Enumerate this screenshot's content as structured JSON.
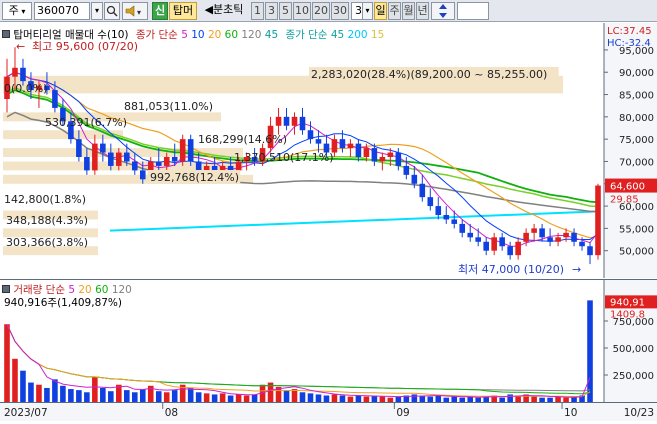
{
  "toolbar": {
    "market": "주",
    "code": "360070",
    "search_icon": "magnifier-icon",
    "sound_icon": "speaker-icon",
    "new_button": "신",
    "tab_button": "탑머",
    "split_label": "◀분초틱",
    "period_buttons": [
      "1",
      "3",
      "5",
      "10",
      "20",
      "30"
    ],
    "count_value": "3",
    "day_button": "일",
    "week_button": "주",
    "month_button": "월",
    "year_button": "년",
    "updown_icon": "updown-arrow-icon"
  },
  "price_header": {
    "stock": "탑머티리얼 매물대 수(10)",
    "sma_label": "종가 단순",
    "sma_periods": [
      "5",
      "10",
      "20",
      "60",
      "120",
      "45"
    ],
    "sma_colors": [
      "#d020d0",
      "#0040ff",
      "#f0a020",
      "#10b010",
      "#808080",
      "#00a0a0"
    ],
    "env_label": "종가 단순",
    "env_periods": [
      "45",
      "200",
      "15"
    ],
    "env_colors": [
      "#10a0a0",
      "#00c8ff",
      "#e0c040"
    ],
    "lc_label": "LC:37.45",
    "hc_label": "HC:-32.4"
  },
  "annotations": {
    "high": "최고 95,600 (07/20)",
    "low": "최저 47,000 (10/20)",
    "zero": "0(0.0%)",
    "volume_profile": [
      "2,283,020(28.4%)(89,200.00 ~ 85,255.00)",
      "881,053(11.0%)",
      "530,391(6.7%)",
      "168,299(14.6%)",
      "1,370,510(17.1%)",
      "992,768(12.4%)",
      "142,800(1.8%)",
      "348,188(4.3%)",
      "303,366(3.8%)"
    ]
  },
  "price_axis": {
    "ticks": [
      "95,000",
      "90,000",
      "85,000",
      "80,000",
      "75,000",
      "70,000",
      "65,000",
      "60,000",
      "55,000",
      "50,000"
    ],
    "current_price": "64,600",
    "change_label": "29.85"
  },
  "volume_header": {
    "label": "거래량",
    "sma_label": "단순",
    "sma_periods": [
      "5",
      "20",
      "60",
      "120"
    ],
    "sma_colors": [
      "#d020d0",
      "#f0a020",
      "#10b010",
      "#808080"
    ],
    "last_value": "940,916주(1,409,87%)"
  },
  "volume_axis": {
    "ticks": [
      "750,000",
      "500,000",
      "250,000"
    ],
    "current_volume": "940,91",
    "current_pct": "1409.8"
  },
  "date_axis": {
    "labels": [
      "2023/07",
      "08",
      "09",
      "10",
      "10/23"
    ]
  },
  "chart_data": {
    "type": "candlestick",
    "ylim": [
      45000,
      97000
    ],
    "volume_ylim": [
      0,
      1000000
    ],
    "candles": [
      {
        "o": 84000,
        "h": 93000,
        "l": 81000,
        "c": 89000
      },
      {
        "o": 89000,
        "h": 95600,
        "l": 86000,
        "c": 91000
      },
      {
        "o": 91000,
        "h": 93000,
        "l": 87000,
        "c": 88000
      },
      {
        "o": 88000,
        "h": 90000,
        "l": 84000,
        "c": 86000
      },
      {
        "o": 86000,
        "h": 88000,
        "l": 82000,
        "c": 87000
      },
      {
        "o": 87000,
        "h": 90000,
        "l": 85000,
        "c": 86000
      },
      {
        "o": 86000,
        "h": 88000,
        "l": 81000,
        "c": 82000
      },
      {
        "o": 82000,
        "h": 84000,
        "l": 78000,
        "c": 79000
      },
      {
        "o": 79000,
        "h": 81000,
        "l": 74000,
        "c": 75000
      },
      {
        "o": 75000,
        "h": 77000,
        "l": 70000,
        "c": 71000
      },
      {
        "o": 71000,
        "h": 73000,
        "l": 67000,
        "c": 68000
      },
      {
        "o": 68000,
        "h": 76000,
        "l": 67000,
        "c": 74000
      },
      {
        "o": 74000,
        "h": 76000,
        "l": 70000,
        "c": 72000
      },
      {
        "o": 72000,
        "h": 74000,
        "l": 68000,
        "c": 69000
      },
      {
        "o": 69000,
        "h": 73000,
        "l": 68000,
        "c": 72000
      },
      {
        "o": 72000,
        "h": 74000,
        "l": 69000,
        "c": 70000
      },
      {
        "o": 70000,
        "h": 72000,
        "l": 67000,
        "c": 68000
      },
      {
        "o": 68000,
        "h": 70000,
        "l": 65000,
        "c": 66000
      },
      {
        "o": 66000,
        "h": 71000,
        "l": 65000,
        "c": 70000
      },
      {
        "o": 70000,
        "h": 73000,
        "l": 68000,
        "c": 69000
      },
      {
        "o": 69000,
        "h": 72000,
        "l": 67000,
        "c": 71000
      },
      {
        "o": 71000,
        "h": 74000,
        "l": 69000,
        "c": 70000
      },
      {
        "o": 70000,
        "h": 76000,
        "l": 69000,
        "c": 75000
      },
      {
        "o": 75000,
        "h": 76000,
        "l": 69000,
        "c": 70000
      },
      {
        "o": 70000,
        "h": 72000,
        "l": 67000,
        "c": 68000
      },
      {
        "o": 68000,
        "h": 70000,
        "l": 66000,
        "c": 69000
      },
      {
        "o": 69000,
        "h": 71000,
        "l": 66000,
        "c": 67000
      },
      {
        "o": 67000,
        "h": 70000,
        "l": 66000,
        "c": 69000
      },
      {
        "o": 69000,
        "h": 71000,
        "l": 67000,
        "c": 68000
      },
      {
        "o": 68000,
        "h": 71000,
        "l": 66000,
        "c": 70000
      },
      {
        "o": 70000,
        "h": 72000,
        "l": 68000,
        "c": 71000
      },
      {
        "o": 71000,
        "h": 73000,
        "l": 69000,
        "c": 70000
      },
      {
        "o": 70000,
        "h": 74000,
        "l": 69000,
        "c": 73000
      },
      {
        "o": 73000,
        "h": 80000,
        "l": 72000,
        "c": 78000
      },
      {
        "o": 78000,
        "h": 82000,
        "l": 76000,
        "c": 80000
      },
      {
        "o": 80000,
        "h": 82000,
        "l": 77000,
        "c": 78000
      },
      {
        "o": 78000,
        "h": 81000,
        "l": 76000,
        "c": 80000
      },
      {
        "o": 80000,
        "h": 82000,
        "l": 76000,
        "c": 77000
      },
      {
        "o": 77000,
        "h": 79000,
        "l": 74000,
        "c": 75000
      },
      {
        "o": 75000,
        "h": 77000,
        "l": 72000,
        "c": 74000
      },
      {
        "o": 74000,
        "h": 76000,
        "l": 71000,
        "c": 72000
      },
      {
        "o": 72000,
        "h": 76000,
        "l": 71000,
        "c": 75000
      },
      {
        "o": 75000,
        "h": 77000,
        "l": 72000,
        "c": 73000
      },
      {
        "o": 73000,
        "h": 75000,
        "l": 71000,
        "c": 74000
      },
      {
        "o": 74000,
        "h": 75000,
        "l": 70000,
        "c": 71000
      },
      {
        "o": 71000,
        "h": 74000,
        "l": 70000,
        "c": 73000
      },
      {
        "o": 73000,
        "h": 74000,
        "l": 69000,
        "c": 70000
      },
      {
        "o": 70000,
        "h": 72000,
        "l": 68000,
        "c": 71000
      },
      {
        "o": 71000,
        "h": 73000,
        "l": 69000,
        "c": 72000
      },
      {
        "o": 72000,
        "h": 73000,
        "l": 68000,
        "c": 69000
      },
      {
        "o": 69000,
        "h": 71000,
        "l": 66000,
        "c": 67000
      },
      {
        "o": 67000,
        "h": 69000,
        "l": 64000,
        "c": 65000
      },
      {
        "o": 65000,
        "h": 67000,
        "l": 61000,
        "c": 62000
      },
      {
        "o": 62000,
        "h": 64000,
        "l": 59000,
        "c": 60000
      },
      {
        "o": 60000,
        "h": 62000,
        "l": 57000,
        "c": 58000
      },
      {
        "o": 58000,
        "h": 60000,
        "l": 56000,
        "c": 57000
      },
      {
        "o": 57000,
        "h": 59000,
        "l": 55000,
        "c": 56000
      },
      {
        "o": 56000,
        "h": 57000,
        "l": 53000,
        "c": 54000
      },
      {
        "o": 54000,
        "h": 56000,
        "l": 52000,
        "c": 53000
      },
      {
        "o": 53000,
        "h": 55000,
        "l": 51000,
        "c": 52000
      },
      {
        "o": 52000,
        "h": 53000,
        "l": 49000,
        "c": 50000
      },
      {
        "o": 50000,
        "h": 54000,
        "l": 49000,
        "c": 53000
      },
      {
        "o": 53000,
        "h": 54000,
        "l": 50000,
        "c": 51000
      },
      {
        "o": 51000,
        "h": 52000,
        "l": 48000,
        "c": 49000
      },
      {
        "o": 49000,
        "h": 53000,
        "l": 48000,
        "c": 52000
      },
      {
        "o": 52000,
        "h": 55000,
        "l": 51000,
        "c": 54000
      },
      {
        "o": 54000,
        "h": 56000,
        "l": 52000,
        "c": 55000
      },
      {
        "o": 55000,
        "h": 56000,
        "l": 52000,
        "c": 53000
      },
      {
        "o": 53000,
        "h": 55000,
        "l": 51000,
        "c": 52000
      },
      {
        "o": 52000,
        "h": 54000,
        "l": 51000,
        "c": 53000
      },
      {
        "o": 53000,
        "h": 55000,
        "l": 52000,
        "c": 54000
      },
      {
        "o": 54000,
        "h": 55000,
        "l": 51000,
        "c": 52000
      },
      {
        "o": 52000,
        "h": 53000,
        "l": 50000,
        "c": 51000
      },
      {
        "o": 51000,
        "h": 52000,
        "l": 47000,
        "c": 49000
      },
      {
        "o": 49000,
        "h": 65000,
        "l": 48000,
        "c": 64600
      }
    ],
    "volumes": [
      720000,
      400000,
      290000,
      180000,
      160000,
      130000,
      210000,
      150000,
      120000,
      110000,
      90000,
      230000,
      130000,
      100000,
      160000,
      110000,
      90000,
      120000,
      150000,
      100000,
      90000,
      110000,
      160000,
      130000,
      90000,
      80000,
      70000,
      80000,
      60000,
      70000,
      60000,
      70000,
      160000,
      180000,
      140000,
      110000,
      120000,
      90000,
      80000,
      70000,
      60000,
      70000,
      60000,
      50000,
      60000,
      50000,
      60000,
      50000,
      40000,
      50000,
      60000,
      70000,
      60000,
      50000,
      60000,
      40000,
      50000,
      40000,
      50000,
      40000,
      50000,
      60000,
      40000,
      70000,
      60000,
      70000,
      50000,
      40000,
      40000,
      50000,
      40000,
      50000,
      60000,
      940916
    ]
  }
}
